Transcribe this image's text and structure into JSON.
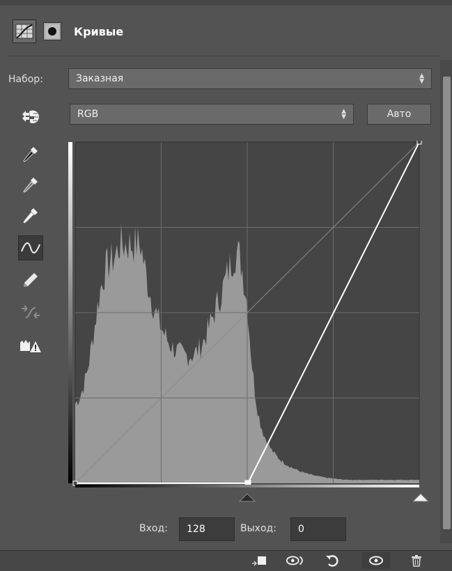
{
  "header": {
    "title": "Кривые",
    "adjustment_icon": "curves-adjustment-icon",
    "mask_icon": "layer-mask-icon"
  },
  "preset": {
    "label": "Набор:",
    "value": "Заказная"
  },
  "channel": {
    "value": "RGB"
  },
  "auto_button": "Авто",
  "tools": [
    {
      "name": "on-image-adjust-icon",
      "active": false
    },
    {
      "name": "black-point-eyedropper-icon",
      "active": false
    },
    {
      "name": "gray-point-eyedropper-icon",
      "active": false
    },
    {
      "name": "white-point-eyedropper-icon",
      "active": false
    },
    {
      "name": "curve-edit-icon",
      "active": true
    },
    {
      "name": "pencil-draw-icon",
      "active": false
    },
    {
      "name": "smooth-curve-icon",
      "active": false
    },
    {
      "name": "clipping-warning-icon",
      "active": false
    }
  ],
  "curve": {
    "points": [
      [
        0,
        0
      ],
      [
        128,
        0
      ],
      [
        255,
        255
      ]
    ],
    "selected_point": [
      128,
      0
    ]
  },
  "input": {
    "label": "Вход:",
    "value": "128"
  },
  "output": {
    "label": "Выход:",
    "value": "0"
  },
  "footer_icons": [
    "clip-to-layer-icon",
    "view-previous-state-icon",
    "reset-icon",
    "visibility-eye-icon",
    "trash-icon"
  ],
  "colors": {
    "panel_bg": "#535353",
    "graph_bg": "#454545",
    "histogram": "#9a9a9a",
    "curve": "#ffffff"
  }
}
